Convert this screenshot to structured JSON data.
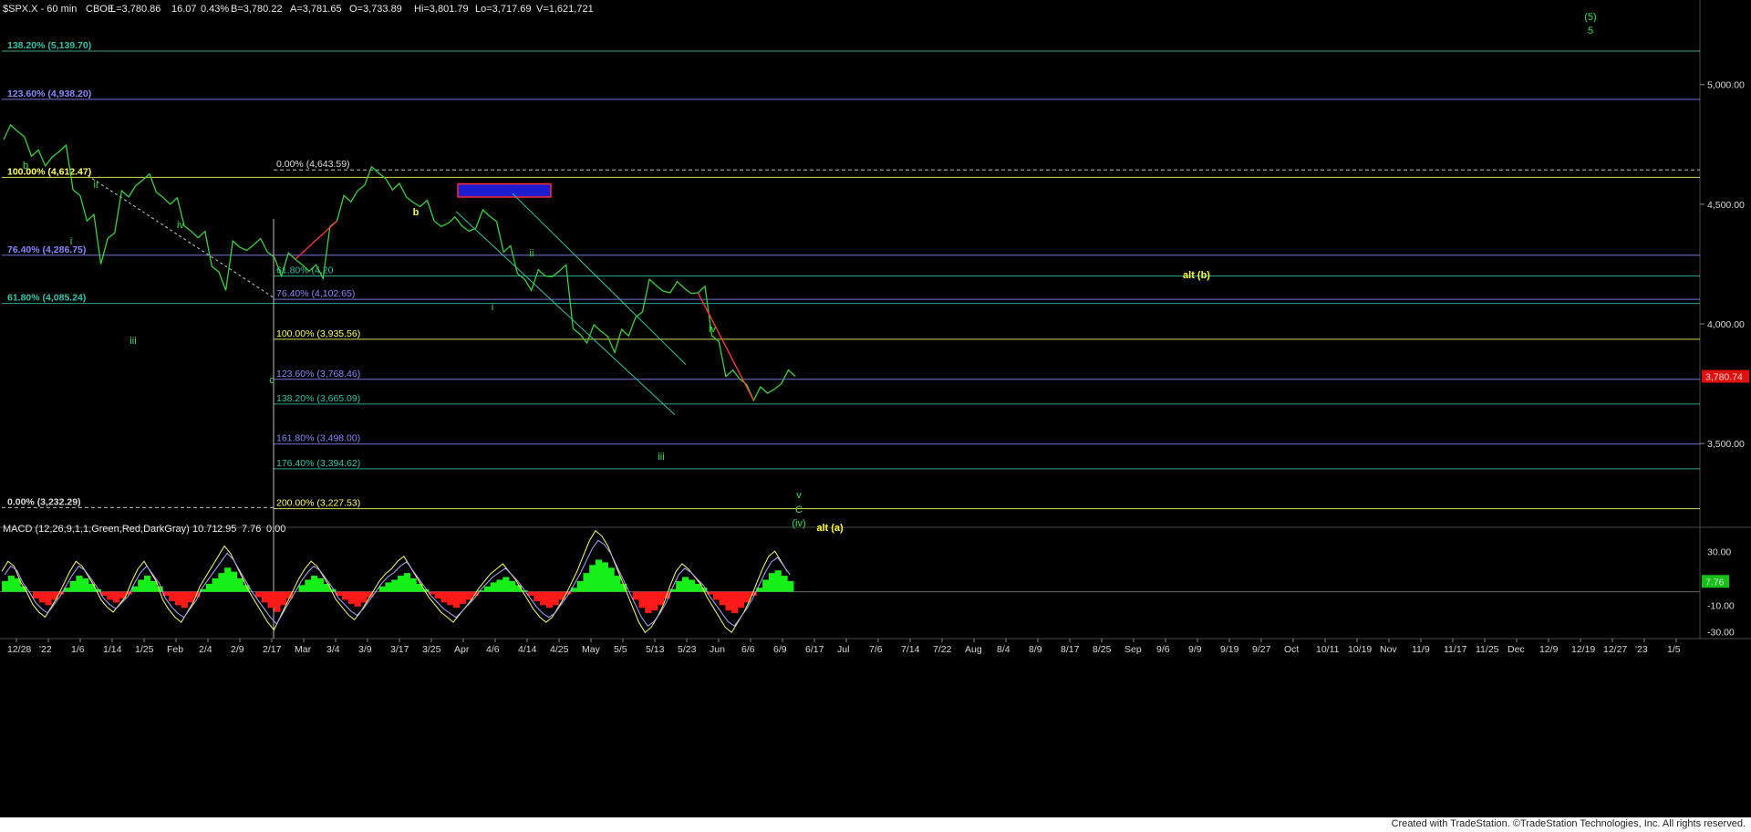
{
  "header": {
    "symbol": "$SPX.X - 60 min",
    "exchange": "CBOE",
    "last": "L=3,780.86",
    "change": "16.07",
    "change_pct": "0.43%",
    "bid": "B=3,780.22",
    "ask": "A=3,781.65",
    "open": "O=3,733.89",
    "hi": "Hi=3,801.79",
    "lo": "Lo=3,717.69",
    "volume": "V=1,621,721"
  },
  "colors": {
    "background": "#000000",
    "price_bar": "#3ccf3c",
    "price_bar_down": "#ff3b3b",
    "fib_blue": "#8888ff",
    "fib_yellow": "#ffff66",
    "fib_teal": "#33c2a8",
    "wave_green": "#39e04f",
    "wave_yellow": "#ffff33",
    "macd_pos": "#16f016",
    "macd_neg": "#ff1a1a",
    "last_price_box": "#e01010"
  },
  "chart_data": [
    {
      "type": "line",
      "title": "$SPX.X - 60 min",
      "series": [
        {
          "name": "",
          "x": [
            "12/28",
            "1/3",
            "1/6",
            "1/10",
            "1/14",
            "1/18",
            "1/21",
            "1/25",
            "1/28",
            "2/1",
            "2/4",
            "2/8",
            "2/10",
            "2/14",
            "2/17",
            "2/22",
            "2/24",
            "2/28",
            "3/2",
            "3/4",
            "3/7",
            "3/9",
            "3/11",
            "3/14",
            "3/17",
            "3/21",
            "3/25",
            "3/29",
            "4/1",
            "4/4",
            "4/6",
            "4/8",
            "4/12",
            "4/14",
            "4/18",
            "4/20",
            "4/22",
            "4/26",
            "4/29",
            "5/3",
            "5/5",
            "5/9",
            "5/12",
            "5/16",
            "5/20",
            "5/24",
            "5/26",
            "5/31",
            "6/3",
            "6/7",
            "6/9",
            "6/10",
            "6/13",
            "6/15",
            "6/16",
            "6/17",
            "6/21",
            "6/22"
          ],
          "values": [
            4770,
            4805,
            4700,
            4660,
            4720,
            4560,
            4430,
            4250,
            4380,
            4530,
            4600,
            4550,
            4500,
            4410,
            4360,
            4240,
            4140,
            4320,
            4330,
            4300,
            4200,
            4270,
            4220,
            4190,
            4430,
            4510,
            4580,
            4630,
            4560,
            4530,
            4490,
            4430,
            4420,
            4410,
            4400,
            4450,
            4300,
            4210,
            4140,
            4200,
            4220,
            3980,
            3920,
            3970,
            3880,
            3950,
            4050,
            4160,
            4130,
            4150,
            4130,
            3950,
            3780,
            3770,
            3680,
            3710,
            3750,
            3781
          ]
        }
      ],
      "ylim": [
        3150,
        5300
      ],
      "x_ticks": [
        "12/28",
        "'22",
        "1/6",
        "1/14",
        "1/25",
        "Feb",
        "2/4",
        "2/9",
        "2/17",
        "Mar",
        "3/4",
        "3/9",
        "3/17",
        "3/25",
        "Apr",
        "4/6",
        "4/14",
        "4/25",
        "May",
        "5/5",
        "5/13",
        "5/23",
        "Jun",
        "6/6",
        "6/9",
        "6/17",
        "Jul",
        "7/6",
        "7/14",
        "7/22",
        "Aug",
        "8/4",
        "8/9",
        "8/17",
        "8/25",
        "Sep",
        "9/6",
        "9/9",
        "9/19",
        "9/27",
        "Oct",
        "10/11",
        "10/19",
        "Nov",
        "11/9",
        "11/17",
        "11/25",
        "Dec",
        "12/9",
        "12/19",
        "12/27",
        "'23",
        "1/5"
      ],
      "y_ticks": [
        "5,000.00",
        "4,500.00",
        "4,000.00",
        "3,500.00"
      ],
      "last_price_label": "3,780.74",
      "fib_levels": [
        {
          "label": "138.20% (5,139.70)",
          "value": 5139.7,
          "color": "teal"
        },
        {
          "label": "123.60% (4,938.20)",
          "value": 4938.2,
          "color": "blue"
        },
        {
          "label": "0.00% (4,643.59)",
          "value": 4643.59,
          "color": "white"
        },
        {
          "label": "100.00% (4,612.47)",
          "value": 4612.47,
          "color": "yellow"
        },
        {
          "label": "76.40% (4,286.75)",
          "value": 4286.75,
          "color": "blue"
        },
        {
          "label": "61.80% (4,20",
          "value": 4200,
          "color": "teal"
        },
        {
          "label": "76.40% (4,102.65)",
          "value": 4102.65,
          "color": "blue"
        },
        {
          "label": "61.80% (4,085.24)",
          "value": 4085.24,
          "color": "teal"
        },
        {
          "label": "100.00% (3,935.56)",
          "value": 3935.56,
          "color": "yellow"
        },
        {
          "label": "123.60% (3,768.46)",
          "value": 3768.46,
          "color": "blue"
        },
        {
          "label": "138.20% (3,665.09)",
          "value": 3665.09,
          "color": "teal"
        },
        {
          "label": "161.80% (3,498.00)",
          "value": 3498.0,
          "color": "blue"
        },
        {
          "label": "176.40% (3,394.62)",
          "value": 3394.62,
          "color": "teal"
        },
        {
          "label": "200.00% (3,227.53)",
          "value": 3227.53,
          "color": "yellow"
        },
        {
          "label": "0.00% (3,232.29)",
          "value": 3232.29,
          "color": "white"
        }
      ],
      "wave_labels": [
        {
          "text": "b",
          "color": "green"
        },
        {
          "text": "ii",
          "color": "green"
        },
        {
          "text": "i",
          "color": "green"
        },
        {
          "text": "iv",
          "color": "green"
        },
        {
          "text": "iii",
          "color": "green"
        },
        {
          "text": "c",
          "color": "green"
        },
        {
          "text": "b",
          "color": "yellow"
        },
        {
          "text": "ii",
          "color": "green"
        },
        {
          "text": "i",
          "color": "green"
        },
        {
          "text": "iv",
          "color": "green"
        },
        {
          "text": "iii",
          "color": "green"
        },
        {
          "text": "v",
          "color": "green"
        },
        {
          "text": "C",
          "color": "green"
        },
        {
          "text": "(iv)",
          "color": "green"
        },
        {
          "text": "alt (a)",
          "color": "yellow"
        },
        {
          "text": "alt (b)",
          "color": "yellow"
        },
        {
          "text": "(5)",
          "color": "green"
        },
        {
          "text": "5",
          "color": "green"
        }
      ]
    },
    {
      "type": "bar",
      "title": "MACD (12,26,9,1,1,Green,Red,DarkGray)",
      "readouts": [
        "10.71",
        "2.95",
        "7.76",
        "0.00"
      ],
      "ylim": [
        -35,
        40
      ],
      "y_ticks": [
        "30.00",
        "-10.00",
        "-30.00"
      ],
      "last_value_label": "7.76",
      "series": [
        {
          "name": "",
          "values": [
            8,
            12,
            10,
            4,
            0,
            -5,
            -8,
            -10,
            -6,
            -2,
            3,
            8,
            12,
            10,
            6,
            2,
            -3,
            -6,
            -8,
            -5,
            -2,
            4,
            9,
            12,
            8,
            4,
            -3,
            -7,
            -10,
            -12,
            -8,
            -4,
            2,
            6,
            10,
            14,
            18,
            15,
            10,
            5,
            0,
            -4,
            -8,
            -12,
            -15,
            -10,
            -5,
            0,
            5,
            9,
            12,
            10,
            6,
            2,
            -3,
            -6,
            -9,
            -11,
            -8,
            -4,
            0,
            4,
            7,
            9,
            12,
            14,
            10,
            6,
            2,
            -2,
            -5,
            -8,
            -10,
            -12,
            -9,
            -6,
            -3,
            1,
            4,
            7,
            9,
            11,
            8,
            5,
            1,
            -3,
            -7,
            -10,
            -12,
            -10,
            -6,
            -2,
            3,
            8,
            14,
            20,
            24,
            22,
            18,
            12,
            6,
            0,
            -6,
            -12,
            -16,
            -14,
            -10,
            -5,
            2,
            8,
            11,
            9,
            6,
            3,
            -2,
            -6,
            -10,
            -14,
            -16,
            -12,
            -8,
            -3,
            3,
            9,
            14,
            16,
            12,
            8
          ]
        }
      ]
    }
  ],
  "footer": {
    "credit": "Created with TradeStation. ©TradeStation Technologies, Inc. All rights reserved."
  }
}
